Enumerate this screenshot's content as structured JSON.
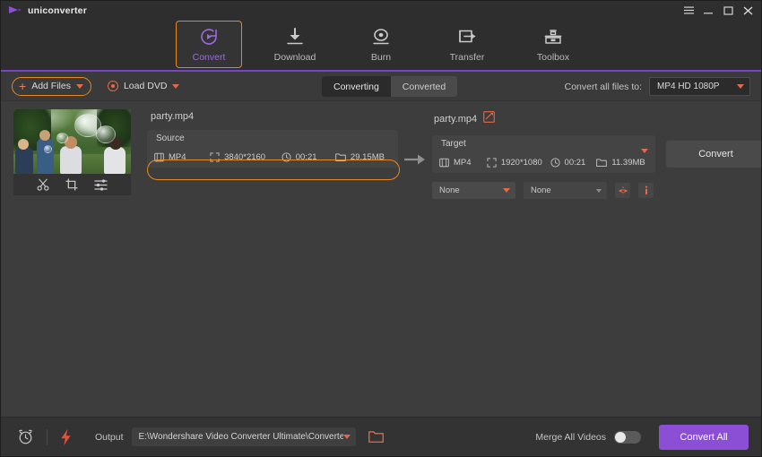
{
  "window": {
    "app_title": "uniconverter",
    "controls": [
      {
        "name": "menu",
        "glyph": "menu-icon"
      },
      {
        "name": "minimize",
        "glyph": "minimize-icon"
      },
      {
        "name": "maximize",
        "glyph": "maximize-icon"
      },
      {
        "name": "close",
        "glyph": "close-icon"
      }
    ]
  },
  "colors": {
    "accent_purple": "#8a4fd4",
    "accent_orange": "#e8871e",
    "accent_red": "#e06a4a",
    "header_bg": "#2e2e2e",
    "content_bg": "#3d3d3d",
    "panel_bg": "#444444",
    "bottom_bg": "#333333"
  },
  "nav": {
    "items": [
      {
        "label": "Convert",
        "icon": "convert-icon",
        "active": true
      },
      {
        "label": "Download",
        "icon": "download-icon",
        "active": false
      },
      {
        "label": "Burn",
        "icon": "burn-icon",
        "active": false
      },
      {
        "label": "Transfer",
        "icon": "transfer-icon",
        "active": false
      },
      {
        "label": "Toolbox",
        "icon": "toolbox-icon",
        "active": false
      }
    ]
  },
  "toolbar": {
    "add_files_label": "Add Files",
    "load_dvd_label": "Load DVD",
    "tabs": [
      {
        "label": "Converting",
        "active": true
      },
      {
        "label": "Converted",
        "active": false
      }
    ],
    "convert_all_to_label": "Convert all files to:",
    "convert_all_to_value": "MP4 HD 1080P"
  },
  "file": {
    "source_name": "party.mp4",
    "target_name": "party.mp4",
    "thumbnail_tools": [
      {
        "name": "trim-icon"
      },
      {
        "name": "crop-icon"
      },
      {
        "name": "effect-icon"
      }
    ],
    "source": {
      "title": "Source",
      "format": "MP4",
      "resolution": "3840*2160",
      "duration": "00:21",
      "size": "29.15MB"
    },
    "target": {
      "title": "Target",
      "format": "MP4",
      "resolution": "1920*1080",
      "duration": "00:21",
      "size": "11.39MB"
    },
    "convert_button_label": "Convert",
    "options": [
      {
        "label": "None",
        "name": "subtitle-select"
      },
      {
        "label": "None",
        "name": "audio-select"
      }
    ]
  },
  "bottom": {
    "output_label": "Output",
    "output_path": "E:\\Wondershare Video Converter Ultimate\\Converted",
    "merge_label": "Merge All Videos",
    "merge_on": false,
    "convert_all_label": "Convert All"
  }
}
